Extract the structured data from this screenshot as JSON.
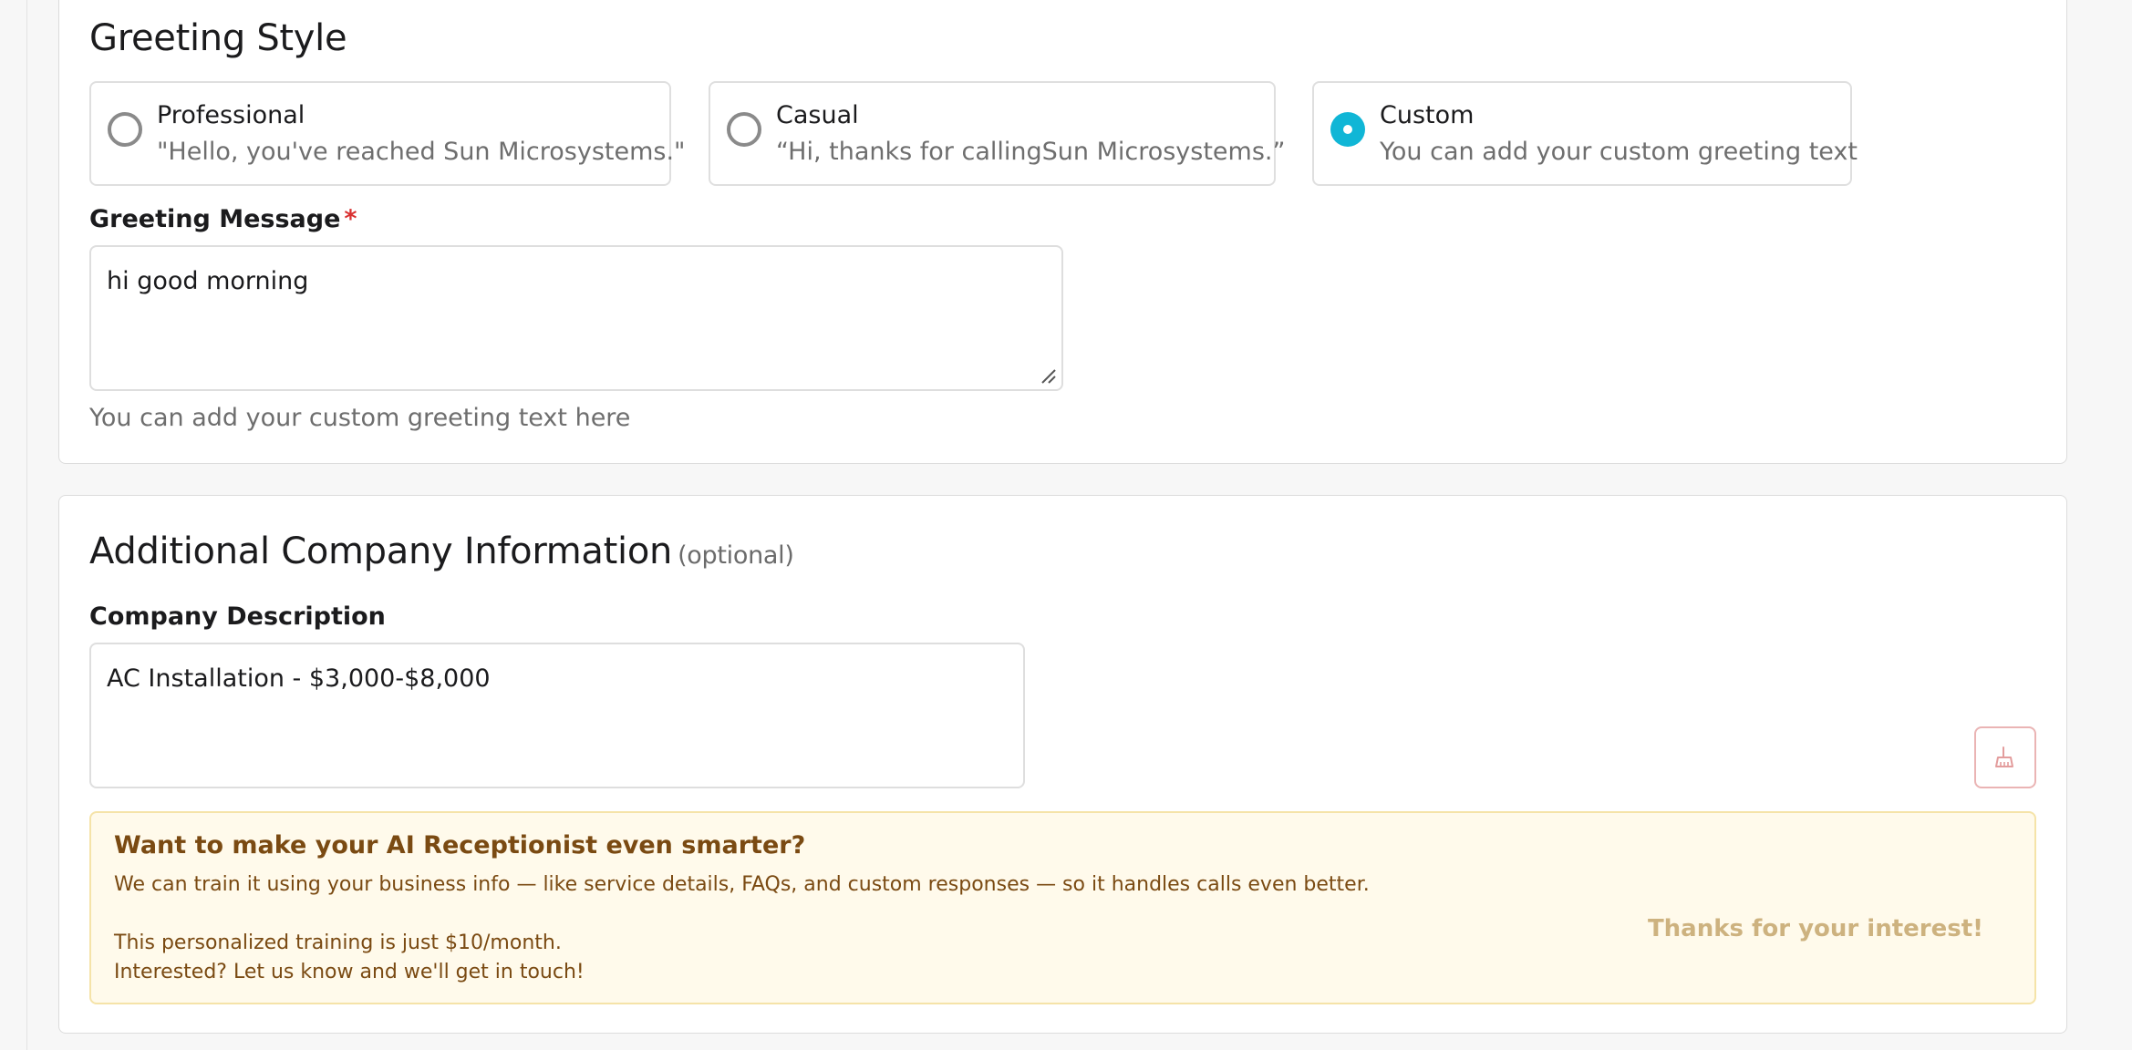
{
  "greeting": {
    "title": "Greeting Style",
    "options": [
      {
        "label": "Professional",
        "description": "\"Hello, you've reached Sun Microsystems.\"",
        "selected": false
      },
      {
        "label": "Casual",
        "description": "“Hi, thanks for callingSun Microsystems.”",
        "selected": false
      },
      {
        "label": "Custom",
        "description": "You can add your custom greeting text",
        "selected": true
      }
    ],
    "message_label": "Greeting Message",
    "required_mark": "*",
    "message_value": "hi good morning",
    "helper": "You can add your custom greeting text here"
  },
  "company": {
    "title": "Additional Company Information",
    "optional": "(optional)",
    "description_label": "Company Description",
    "description_value": "AC Installation - $3,000-$8,000",
    "clear_icon": "broom-icon"
  },
  "promo": {
    "title": "Want to make your AI Receptionist even smarter?",
    "line1": "We can train it using your business info — like service details, FAQs, and custom responses — so it handles calls even better.",
    "line2": "This personalized training is just $10/month.",
    "line3": "Interested? Let us know and we'll get in touch!",
    "thanks": "Thanks for your interest!"
  },
  "colors": {
    "accent": "#10b6d6",
    "required": "#d93030",
    "promo_bg": "#fffaeb",
    "promo_text": "#7a4a12"
  }
}
